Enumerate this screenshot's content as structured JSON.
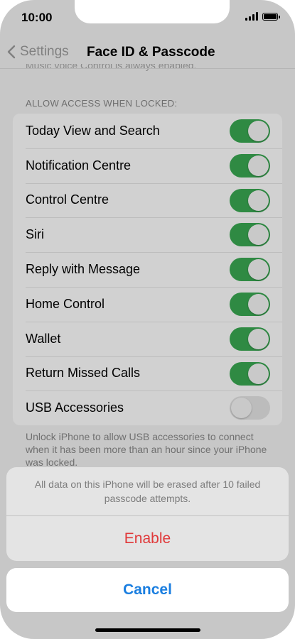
{
  "status_bar": {
    "time": "10:00"
  },
  "navbar": {
    "back_label": "Settings",
    "title": "Face ID & Passcode"
  },
  "cut_off_text": "Music voice Control is always enabled.",
  "section": {
    "header": "ALLOW ACCESS WHEN LOCKED:",
    "items": [
      {
        "label": "Today View and Search",
        "on": true
      },
      {
        "label": "Notification Centre",
        "on": true
      },
      {
        "label": "Control Centre",
        "on": true
      },
      {
        "label": "Siri",
        "on": true
      },
      {
        "label": "Reply with Message",
        "on": true
      },
      {
        "label": "Home Control",
        "on": true
      },
      {
        "label": "Wallet",
        "on": true
      },
      {
        "label": "Return Missed Calls",
        "on": true
      },
      {
        "label": "USB Accessories",
        "on": false
      }
    ],
    "footer": "Unlock iPhone to allow USB accessories to connect when it has been more than an hour since your iPhone was locked."
  },
  "action_sheet": {
    "message": "All data on this iPhone will be erased after 10 failed passcode attempts.",
    "enable_label": "Enable",
    "cancel_label": "Cancel"
  },
  "colors": {
    "toggle_on": "#2f8a43",
    "destructive": "#e0393a",
    "accent": "#1a7ee0"
  }
}
